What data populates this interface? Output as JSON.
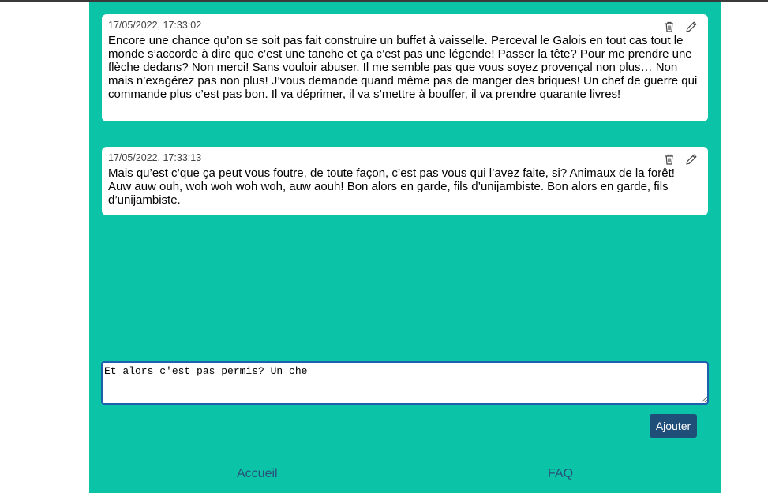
{
  "messages": [
    {
      "date": "17/05/2022, 17:33:02",
      "text": "Encore une chance qu’on se soit pas fait construire un buffet à vaisselle. Perceval le Galois en tout cas tout le monde s’accorde à dire que c’est une tanche et ça c’est pas une légende! Passer la tête? Pour me prendre une flèche dedans? Non merci! Sans vouloir abuser. Il me semble pas que vous soyez provençal non plus… Non mais n’exagérez pas non plus! J’vous demande quand même pas de manger des briques! Un chef de guerre qui commande plus c’est pas bon. Il va déprimer, il va s’mettre à bouffer, il va prendre quarante livres!",
      "delete_icon": "trash-icon",
      "edit_icon": "pencil-icon"
    },
    {
      "date": "17/05/2022, 17:33:13",
      "text": "Mais qu’est c’que ça peut vous foutre, de toute façon, c’est pas vous qui l’avez faite, si? Animaux de la forêt! Auw auw ouh, woh woh woh woh, auw aouh! Bon alors en garde, fils d’unijambiste. Bon alors en garde, fils d’unijambiste.",
      "delete_icon": "trash-icon",
      "edit_icon": "pencil-icon"
    }
  ],
  "composer": {
    "value": "Et alors c'est pas permis? Un che"
  },
  "add_button": {
    "label": "Ajouter"
  },
  "nav": {
    "home": "Accueil",
    "faq": "FAQ"
  },
  "colors": {
    "panel_background": "#0bc4a7",
    "button_background": "#1f4e79",
    "link": "#2a4f7a",
    "focus_border": "#1f5fb0"
  }
}
